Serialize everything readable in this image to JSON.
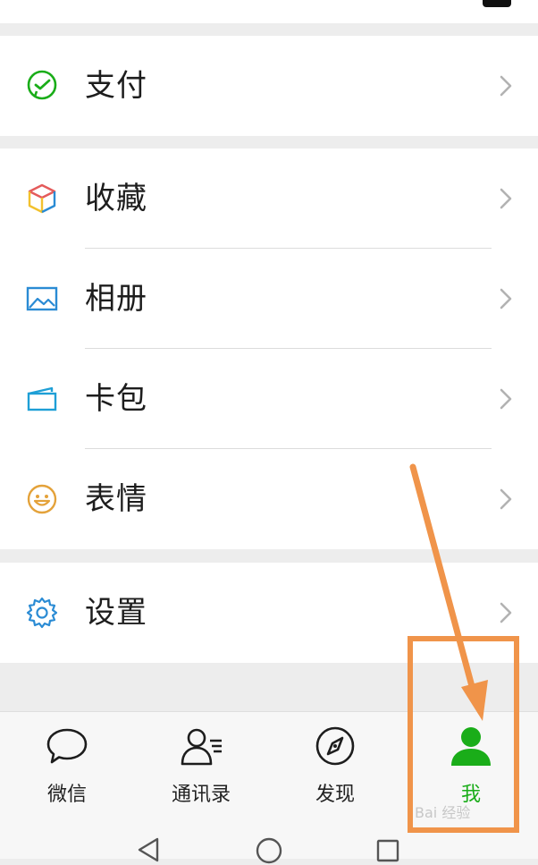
{
  "groups": {
    "pay": {
      "label": "支付",
      "icon": "wechat-pay-icon"
    },
    "services": [
      {
        "label": "收藏",
        "icon": "favorites-cube-icon"
      },
      {
        "label": "相册",
        "icon": "album-picture-icon"
      },
      {
        "label": "卡包",
        "icon": "card-wallet-icon"
      },
      {
        "label": "表情",
        "icon": "smiley-face-icon"
      }
    ],
    "settings": {
      "label": "设置",
      "icon": "gear-icon"
    }
  },
  "tabbar": {
    "tabs": [
      {
        "label": "微信",
        "icon": "chat-bubble-icon",
        "active": false
      },
      {
        "label": "通讯录",
        "icon": "contacts-icon",
        "active": false
      },
      {
        "label": "发现",
        "icon": "compass-icon",
        "active": false
      },
      {
        "label": "我",
        "icon": "person-icon",
        "active": true
      }
    ]
  },
  "navbar": {
    "buttons": [
      "back-triangle-icon",
      "home-circle-icon",
      "recents-square-icon"
    ]
  },
  "watermark": {
    "text": "Bai 经验"
  },
  "colors": {
    "accent_green": "#1aad19",
    "annotation_orange": "#f0944a",
    "pay_green": "#1aad19",
    "album_blue": "#2a8bd4",
    "card_teal": "#1e9fd6",
    "smiley_yellow": "#e4a23a",
    "settings_blue": "#2a8bd4"
  }
}
